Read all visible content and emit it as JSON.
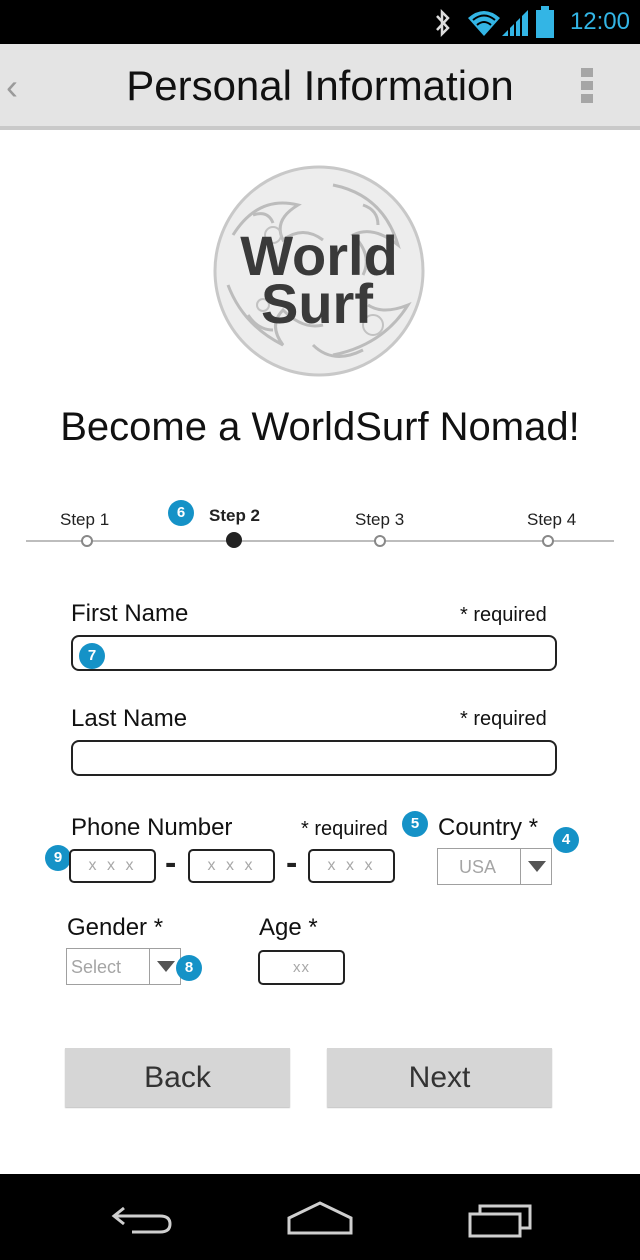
{
  "status_bar": {
    "time": "12:00",
    "icons": [
      "bluetooth-icon",
      "wifi-icon",
      "signal-icon",
      "battery-icon"
    ]
  },
  "action_bar": {
    "title": "Personal Information",
    "back_glyph": "‹"
  },
  "logo": {
    "line1": "World",
    "line2": "Surf"
  },
  "headline": "Become a WorldSurf Nomad!",
  "stepper": {
    "steps": [
      {
        "label": "Step 1",
        "active": false
      },
      {
        "label": "Step 2",
        "active": true
      },
      {
        "label": "Step 3",
        "active": false
      },
      {
        "label": "Step 4",
        "active": false
      }
    ]
  },
  "annotations": [
    "6",
    "7",
    "5",
    "4",
    "9",
    "8"
  ],
  "form": {
    "first_name": {
      "label": "First Name",
      "required": "* required",
      "value": ""
    },
    "last_name": {
      "label": "Last Name",
      "required": "* required",
      "value": ""
    },
    "phone": {
      "label": "Phone Number",
      "required": "* required",
      "placeholders": [
        "x x x",
        "x x x",
        "x x x"
      ],
      "separator": "-"
    },
    "country": {
      "label": "Country *",
      "value": "USA"
    },
    "gender": {
      "label": "Gender *",
      "value": "Select"
    },
    "age": {
      "label": "Age *",
      "placeholder": "xx"
    }
  },
  "buttons": {
    "back": "Back",
    "next": "Next"
  },
  "colors": {
    "accent": "#33b5e5",
    "badge": "#1592c7",
    "action_bar": "#e4e4e4",
    "button": "#d6d6d6"
  }
}
